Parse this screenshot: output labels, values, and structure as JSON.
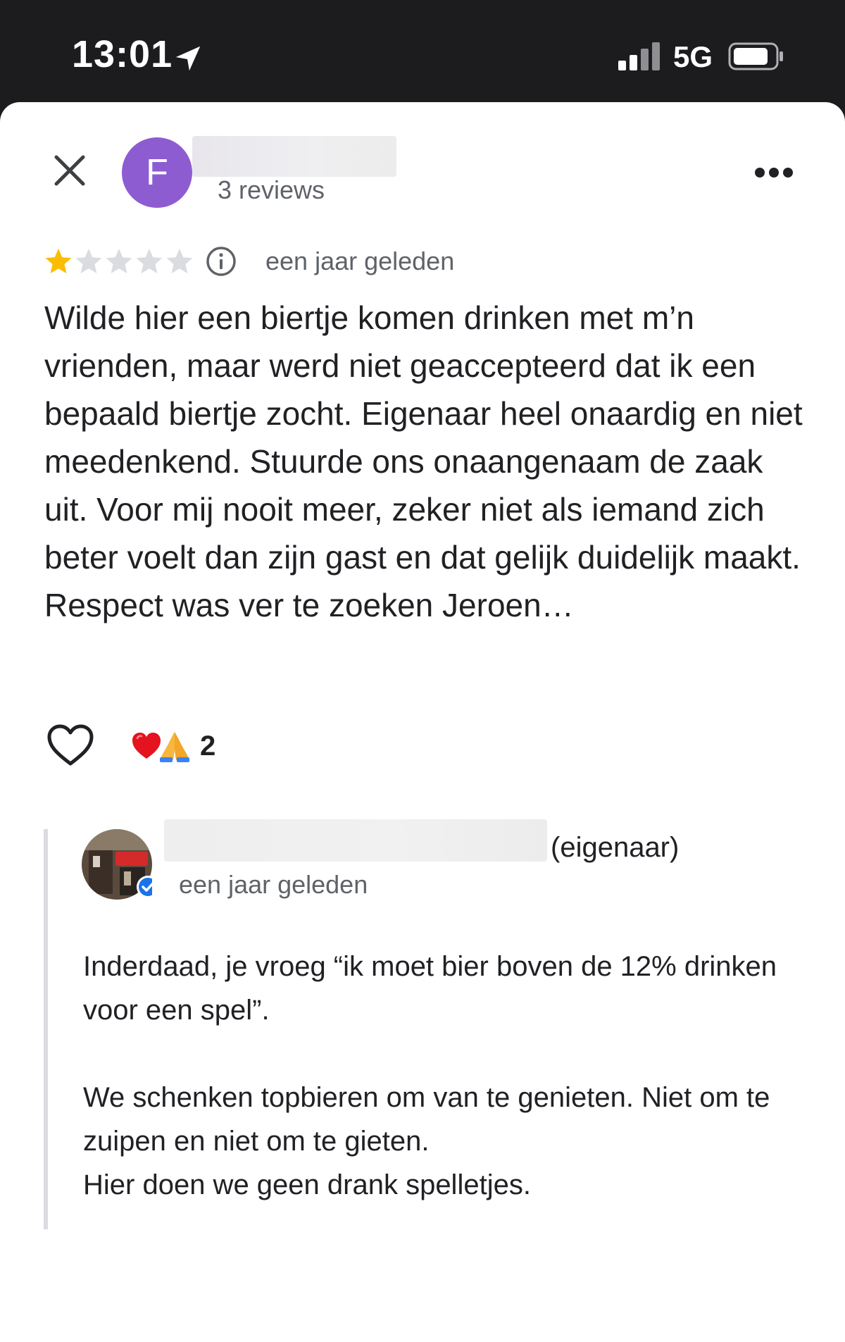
{
  "status_bar": {
    "time": "13:01",
    "network": "5G",
    "icons": [
      "location-arrow-icon",
      "signal-icon",
      "battery-icon"
    ]
  },
  "review": {
    "avatar_letter": "F",
    "avatar_color": "#8e5cd1",
    "review_count": "3 reviews",
    "rating": 1,
    "rating_max": 5,
    "date": "een jaar geleden",
    "text": "Wilde hier een biertje komen drinken met m’n vrienden, maar werd niet geaccepteerd dat ik een bepaald biertje zocht. Eigenaar heel onaardig en niet meedenkend. Stuurde ons onaangenaam de zaak uit. Voor mij nooit meer, zeker niet als iemand zich beter voelt dan zijn gast en dat gelijk duidelijk maakt. Respect was ver te zoeken Jeroen…",
    "reaction_count": "2"
  },
  "owner_reply": {
    "label": "(eigenaar)",
    "date": "een jaar geleden",
    "paragraphs": [
      "Inderdaad, je vroeg “ik moet bier boven de 12% drinken voor een spel”.",
      "We schenken topbieren om van te genieten. Niet om te zuipen en niet om te gieten.\nHier doen we geen drank spelletjes."
    ]
  },
  "colors": {
    "star_filled": "#fbbc04",
    "star_empty": "#dadce0",
    "verified": "#1a73e8"
  }
}
